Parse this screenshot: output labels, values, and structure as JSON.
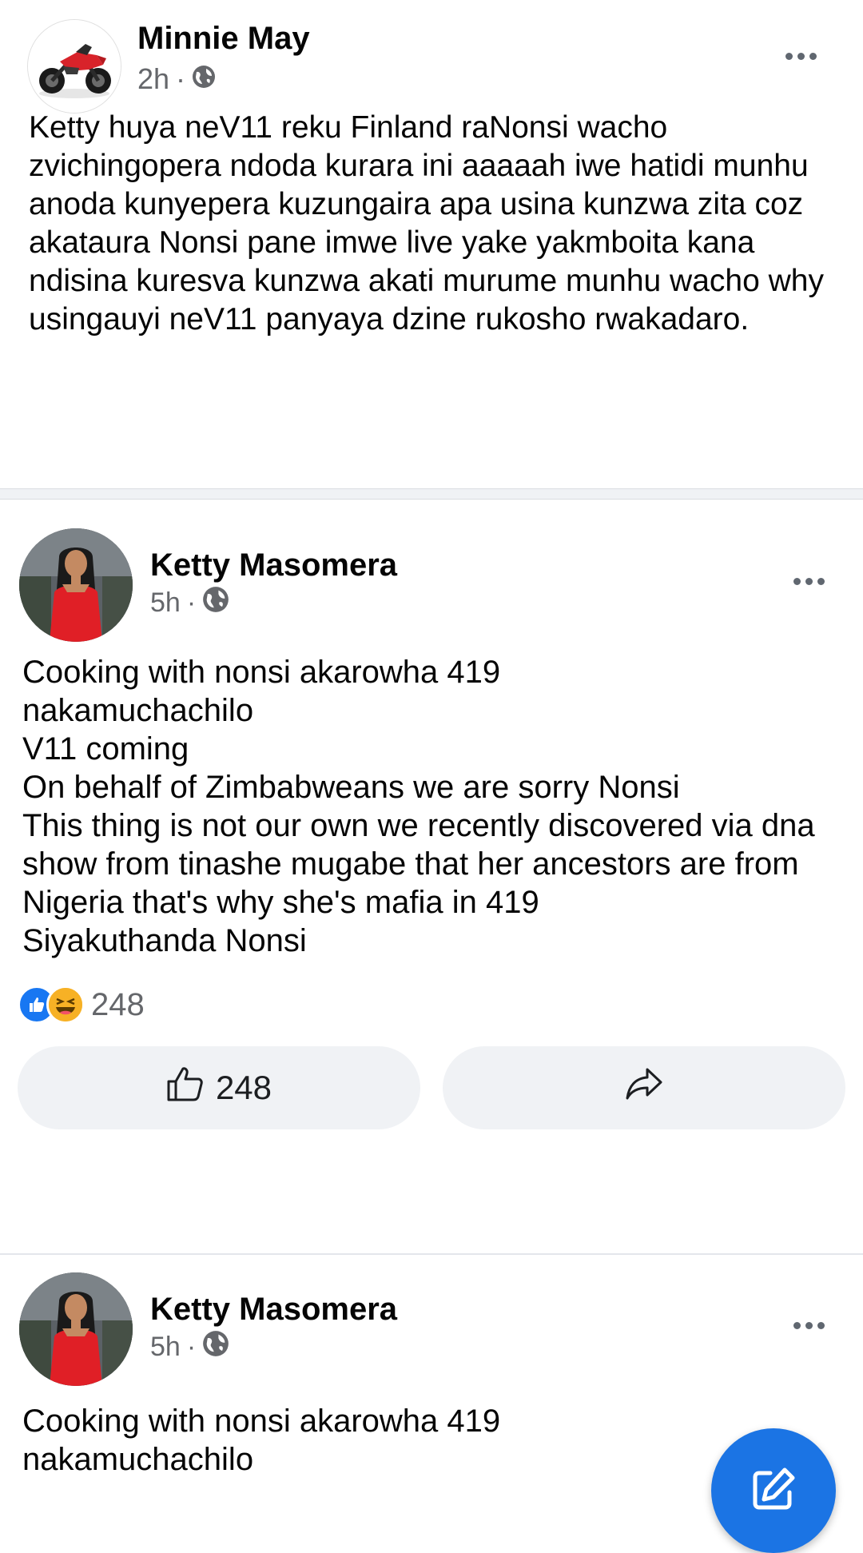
{
  "post1": {
    "author": "Minnie May",
    "time": "2h",
    "separator": "·",
    "privacy_icon": "globe-icon",
    "avatar_icon": "motorcycle-avatar",
    "body": "Ketty huya neV11 reku Finland raNonsi wacho zvichingopera ndoda kurara ini aaaaah iwe hatidi munhu anoda kunyepera kuzungaira apa usina kunzwa zita coz akataura Nonsi pane imwe live yake yakmboita kana ndisina kuresva kunzwa akati murume munhu wacho why usingauyi neV11 panyaya dzine rukosho rwakadaro."
  },
  "post2": {
    "author": "Ketty Masomera",
    "time": "5h",
    "separator": "·",
    "privacy_icon": "globe-icon",
    "avatar_icon": "woman-red-dress-avatar",
    "body": "Cooking with nonsi akarowha 419\nnakamuchachilo\nV11 coming\nOn behalf of Zimbabweans we are sorry Nonsi\nThis thing is not our own we recently discovered via dna show  from tinashe mugabe that her ancestors are from Nigeria that's why she's mafia in 419\nSiyakuthanda Nonsi",
    "reactions": {
      "icons": [
        "like-reaction-icon",
        "haha-reaction-icon"
      ],
      "count": "248"
    },
    "actions": {
      "like_count": "248",
      "like_icon": "thumbs-up-icon",
      "share_icon": "share-icon"
    }
  },
  "post3": {
    "author": "Ketty Masomera",
    "time": "5h",
    "separator": "·",
    "privacy_icon": "globe-icon",
    "avatar_icon": "woman-red-dress-avatar",
    "body": "Cooking with nonsi akarowha 419\nnakamuchachilo"
  },
  "fab": {
    "icon": "compose-icon",
    "color": "#1b74e4"
  },
  "colors": {
    "text_primary": "#050505",
    "text_secondary": "#65676b",
    "facebook_blue": "#1877f2",
    "button_bg": "#f0f2f5"
  }
}
